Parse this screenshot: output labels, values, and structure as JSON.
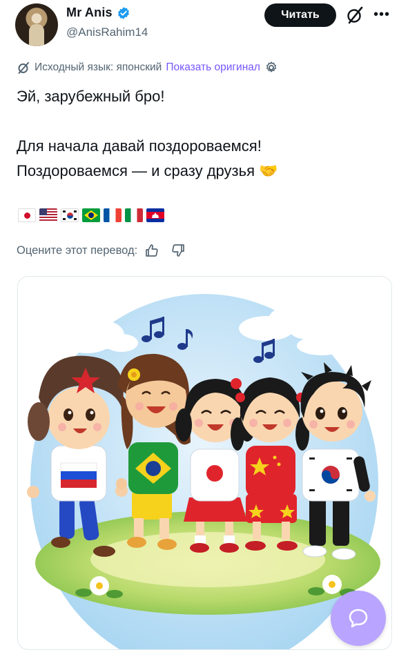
{
  "author": {
    "name": "Mr Anis",
    "handle": "@AnisRahim14",
    "verified": true
  },
  "header": {
    "follow_label": "Читать"
  },
  "translation": {
    "source_label": "Исходный язык: японский",
    "show_original_label": "Показать оригинал"
  },
  "tweet": {
    "lines": [
      "Эй, зарубежный бро!",
      "",
      "Для начала давай поздороваемся!",
      "Поздороваемся — и сразу друзья"
    ],
    "emoji": "🤝"
  },
  "flags": [
    "japan-flag",
    "usa-flag",
    "south-korea-flag",
    "brazil-flag",
    "france-flag",
    "italy-flag",
    "cambodia-flag"
  ],
  "rating": {
    "label": "Оцените этот перевод:"
  },
  "colors": {
    "accent": "#7856ff",
    "verified": "#1d9bf0",
    "fab": "#b9a4ff",
    "secondary_text": "#536471"
  },
  "media": {
    "kids": [
      {
        "outfit": "russia"
      },
      {
        "outfit": "brazil"
      },
      {
        "outfit": "japan"
      },
      {
        "outfit": "china"
      },
      {
        "outfit": "south-korea"
      }
    ]
  }
}
